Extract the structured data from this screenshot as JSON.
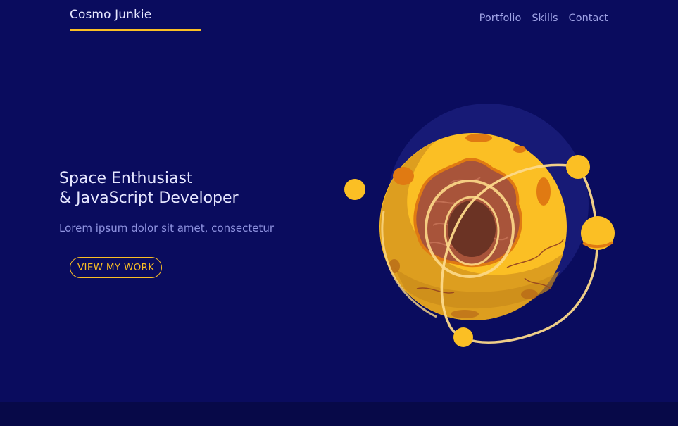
{
  "header": {
    "brand": "Cosmo Junkie",
    "nav": [
      {
        "label": "Portfolio"
      },
      {
        "label": "Skills"
      },
      {
        "label": "Contact"
      }
    ]
  },
  "hero": {
    "title_line1": "Space Enthusiast",
    "title_line2": "& JavaScript Developer",
    "subtitle": "Lorem ipsum dolor sit amet, consectetur",
    "cta_label": "VIEW MY WORK"
  },
  "theme": {
    "background": "#0a0c5e",
    "footer_band": "#070948",
    "accent": "#fbbf24",
    "text_primary": "#e6e7ff",
    "text_muted": "#8f93e0"
  },
  "illustration": {
    "icon": "planet-illustration"
  }
}
